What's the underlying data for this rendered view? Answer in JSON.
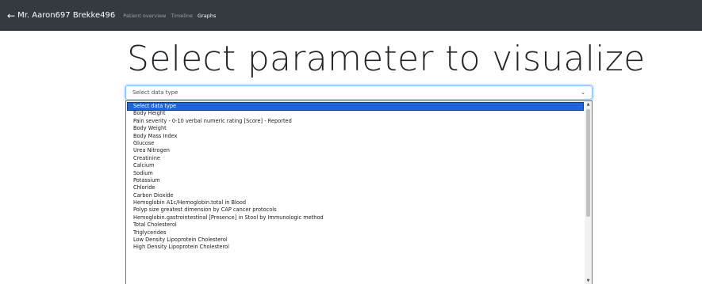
{
  "navbar": {
    "back_icon": "←",
    "patient_name": "Mr. Aaron697 Brekke496",
    "links": [
      {
        "label": "Patient overview",
        "active": false
      },
      {
        "label": "Timeline",
        "active": false
      },
      {
        "label": "Graphs",
        "active": true
      }
    ]
  },
  "main": {
    "title": "Select parameter to visualize",
    "select": {
      "value": "Select data type",
      "caret_icon": "⌄",
      "options": [
        "Select data type",
        "Body Height",
        "Pain severity - 0-10 verbal numeric rating [Score] - Reported",
        "Body Weight",
        "Body Mass Index",
        "Glucose",
        "Urea Nitrogen",
        "Creatinine",
        "Calcium",
        "Sodium",
        "Potassium",
        "Chloride",
        "Carbon Dioxide",
        "Hemoglobin A1c/Hemoglobin.total in Blood",
        "Polyp size greatest dimension by CAP cancer protocols",
        "Hemoglobin.gastrointestinal [Presence] in Stool by Immunologic method",
        "Total Cholesterol",
        "Triglycerides",
        "Low Density Lipoprotein Cholesterol",
        "High Density Lipoprotein Cholesterol"
      ],
      "selected_index": 0
    },
    "scrollbar": {
      "up_icon": "▲",
      "down_icon": "▼"
    }
  },
  "colors": {
    "navbar_bg": "#343a40",
    "selected_option_bg": "#1e66d8",
    "focus_border": "#80bdff"
  }
}
